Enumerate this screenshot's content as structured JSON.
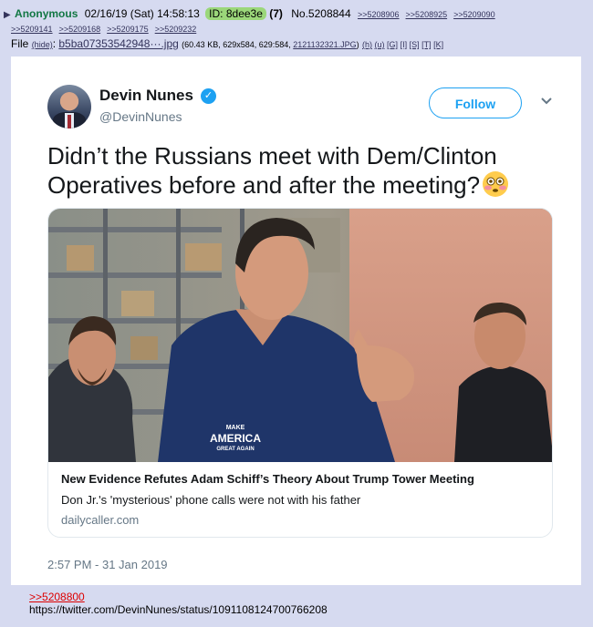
{
  "post": {
    "arrow": "▶",
    "name": "Anonymous",
    "datetime": "02/16/19 (Sat) 14:58:13",
    "id_label": "ID: 8dee3e",
    "reply_count": "(7)",
    "number": "No.5208844",
    "backlinks": [
      ">>5208906",
      ">>5208925",
      ">>5209090",
      ">>5209141",
      ">>5209168",
      ">>5209175",
      ">>5209232"
    ]
  },
  "file": {
    "label": "File",
    "hide": "(hide)",
    "name": "b5ba07353542948···.jpg",
    "meta": "(60.43 KB, 629x584, 629:584, ",
    "original_name": "2121132321.JPG",
    "meta_end": ")",
    "links": [
      "(h)",
      "(u)",
      "[G]",
      "[I]",
      "[S]",
      "[T]",
      "[K]"
    ]
  },
  "tweet": {
    "author_name": "Devin Nunes",
    "verified_mark": "✓",
    "author_handle": "@DevinNunes",
    "follow_label": "Follow",
    "text": "Didn’t the Russians meet with Dem/Clinton Operatives before and after the meeting?",
    "emoji": "flushed-face-icon",
    "card": {
      "shirt_text_1": "MAKE",
      "shirt_text_2": "AMERICA",
      "shirt_text_3": "GREAT AGAIN",
      "title": "New Evidence Refutes Adam Schiff’s Theory About Trump Tower Meeting",
      "description": "Don Jr.'s 'mysterious' phone calls were not with his father",
      "domain": "dailycaller.com"
    },
    "timestamp": "2:57 PM - 31 Jan 2019"
  },
  "comment": {
    "quote_link": ">>5208800",
    "url": "https://twitter.com/DevinNunes/status/1091108124700766208"
  },
  "colors": {
    "background": "#d6daf0",
    "name": "#117743",
    "id_badge": "#9bd77a",
    "link": "#34345c",
    "quote_link": "#dd0000",
    "twitter_blue": "#1da1f2"
  }
}
